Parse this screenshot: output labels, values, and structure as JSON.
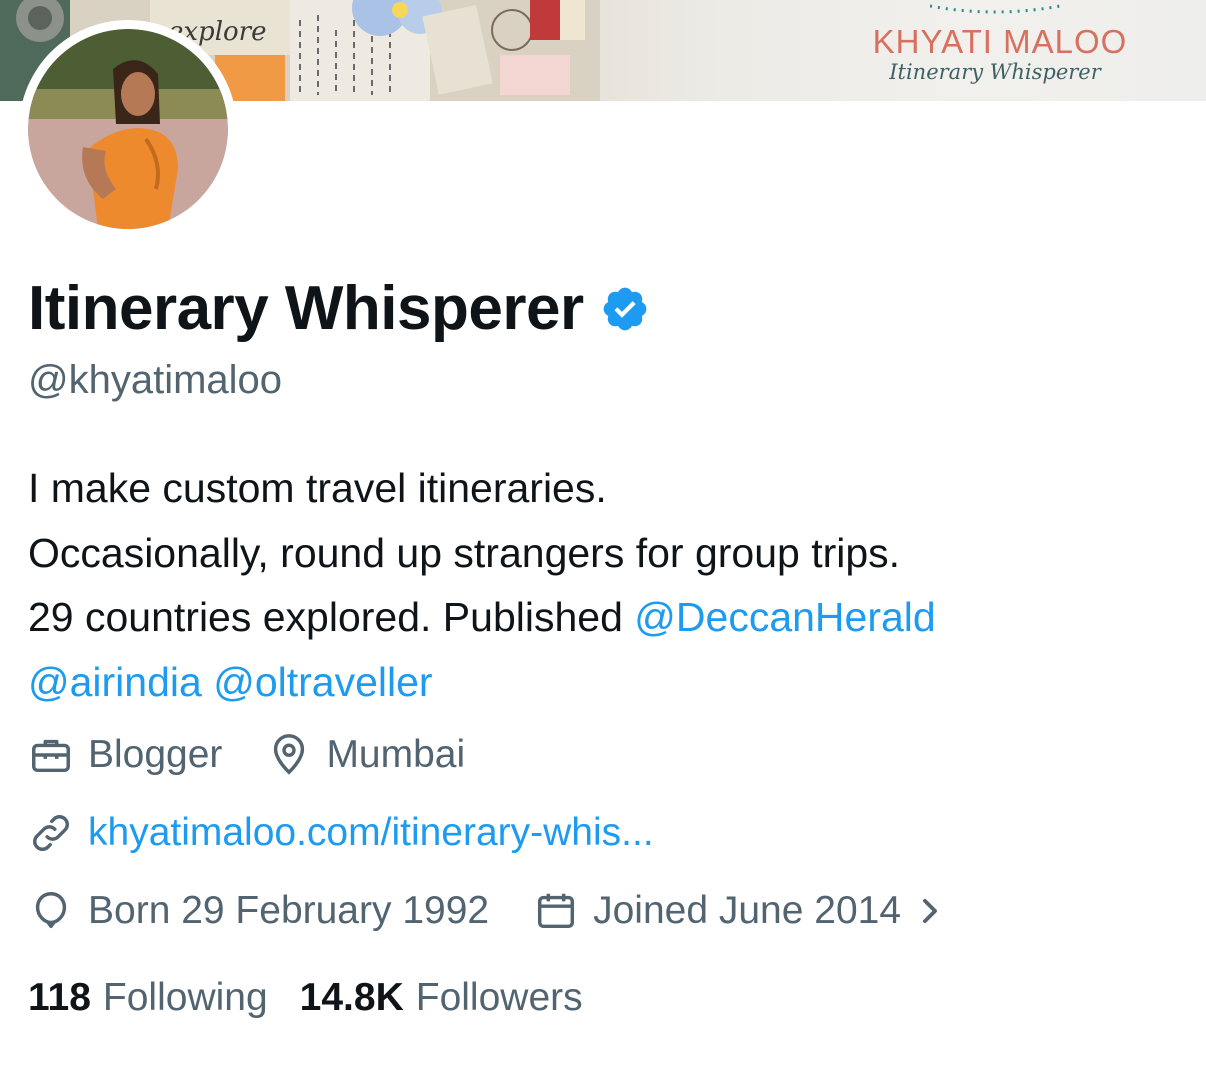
{
  "banner": {
    "brand_name": "KHYATI MALOO",
    "brand_tagline": "Itinerary Whisperer",
    "collage_word": "explore"
  },
  "profile": {
    "display_name": "Itinerary Whisperer",
    "verified": true,
    "handle": "@khyatimaloo",
    "bio": {
      "line1": "I make custom travel itineraries.",
      "line2": "Occasionally, round up strangers for group trips.",
      "line3_text": "29 countries explored. Published ",
      "mentions": [
        "@DeccanHerald",
        "@airindia",
        "@oltraveller"
      ]
    },
    "category": "Blogger",
    "location": "Mumbai",
    "website": "khyatimaloo.com/itinerary-whis...",
    "birthday": "Born 29 February 1992",
    "joined": "Joined June 2014",
    "following_count": "118",
    "following_label": "Following",
    "followers_count": "14.8K",
    "followers_label": "Followers"
  },
  "icons": {
    "category": "briefcase-icon",
    "location": "map-pin-icon",
    "website": "link-icon",
    "birthday": "balloon-icon",
    "joined": "calendar-icon",
    "verified": "verified-badge-icon",
    "more": "chevron-right-icon"
  },
  "colors": {
    "text_primary": "#0f1419",
    "text_secondary": "#536471",
    "link": "#1d9bf0",
    "verified": "#1d9bf0",
    "brand_name": "#d7705e",
    "brand_tagline": "#3e6165"
  }
}
